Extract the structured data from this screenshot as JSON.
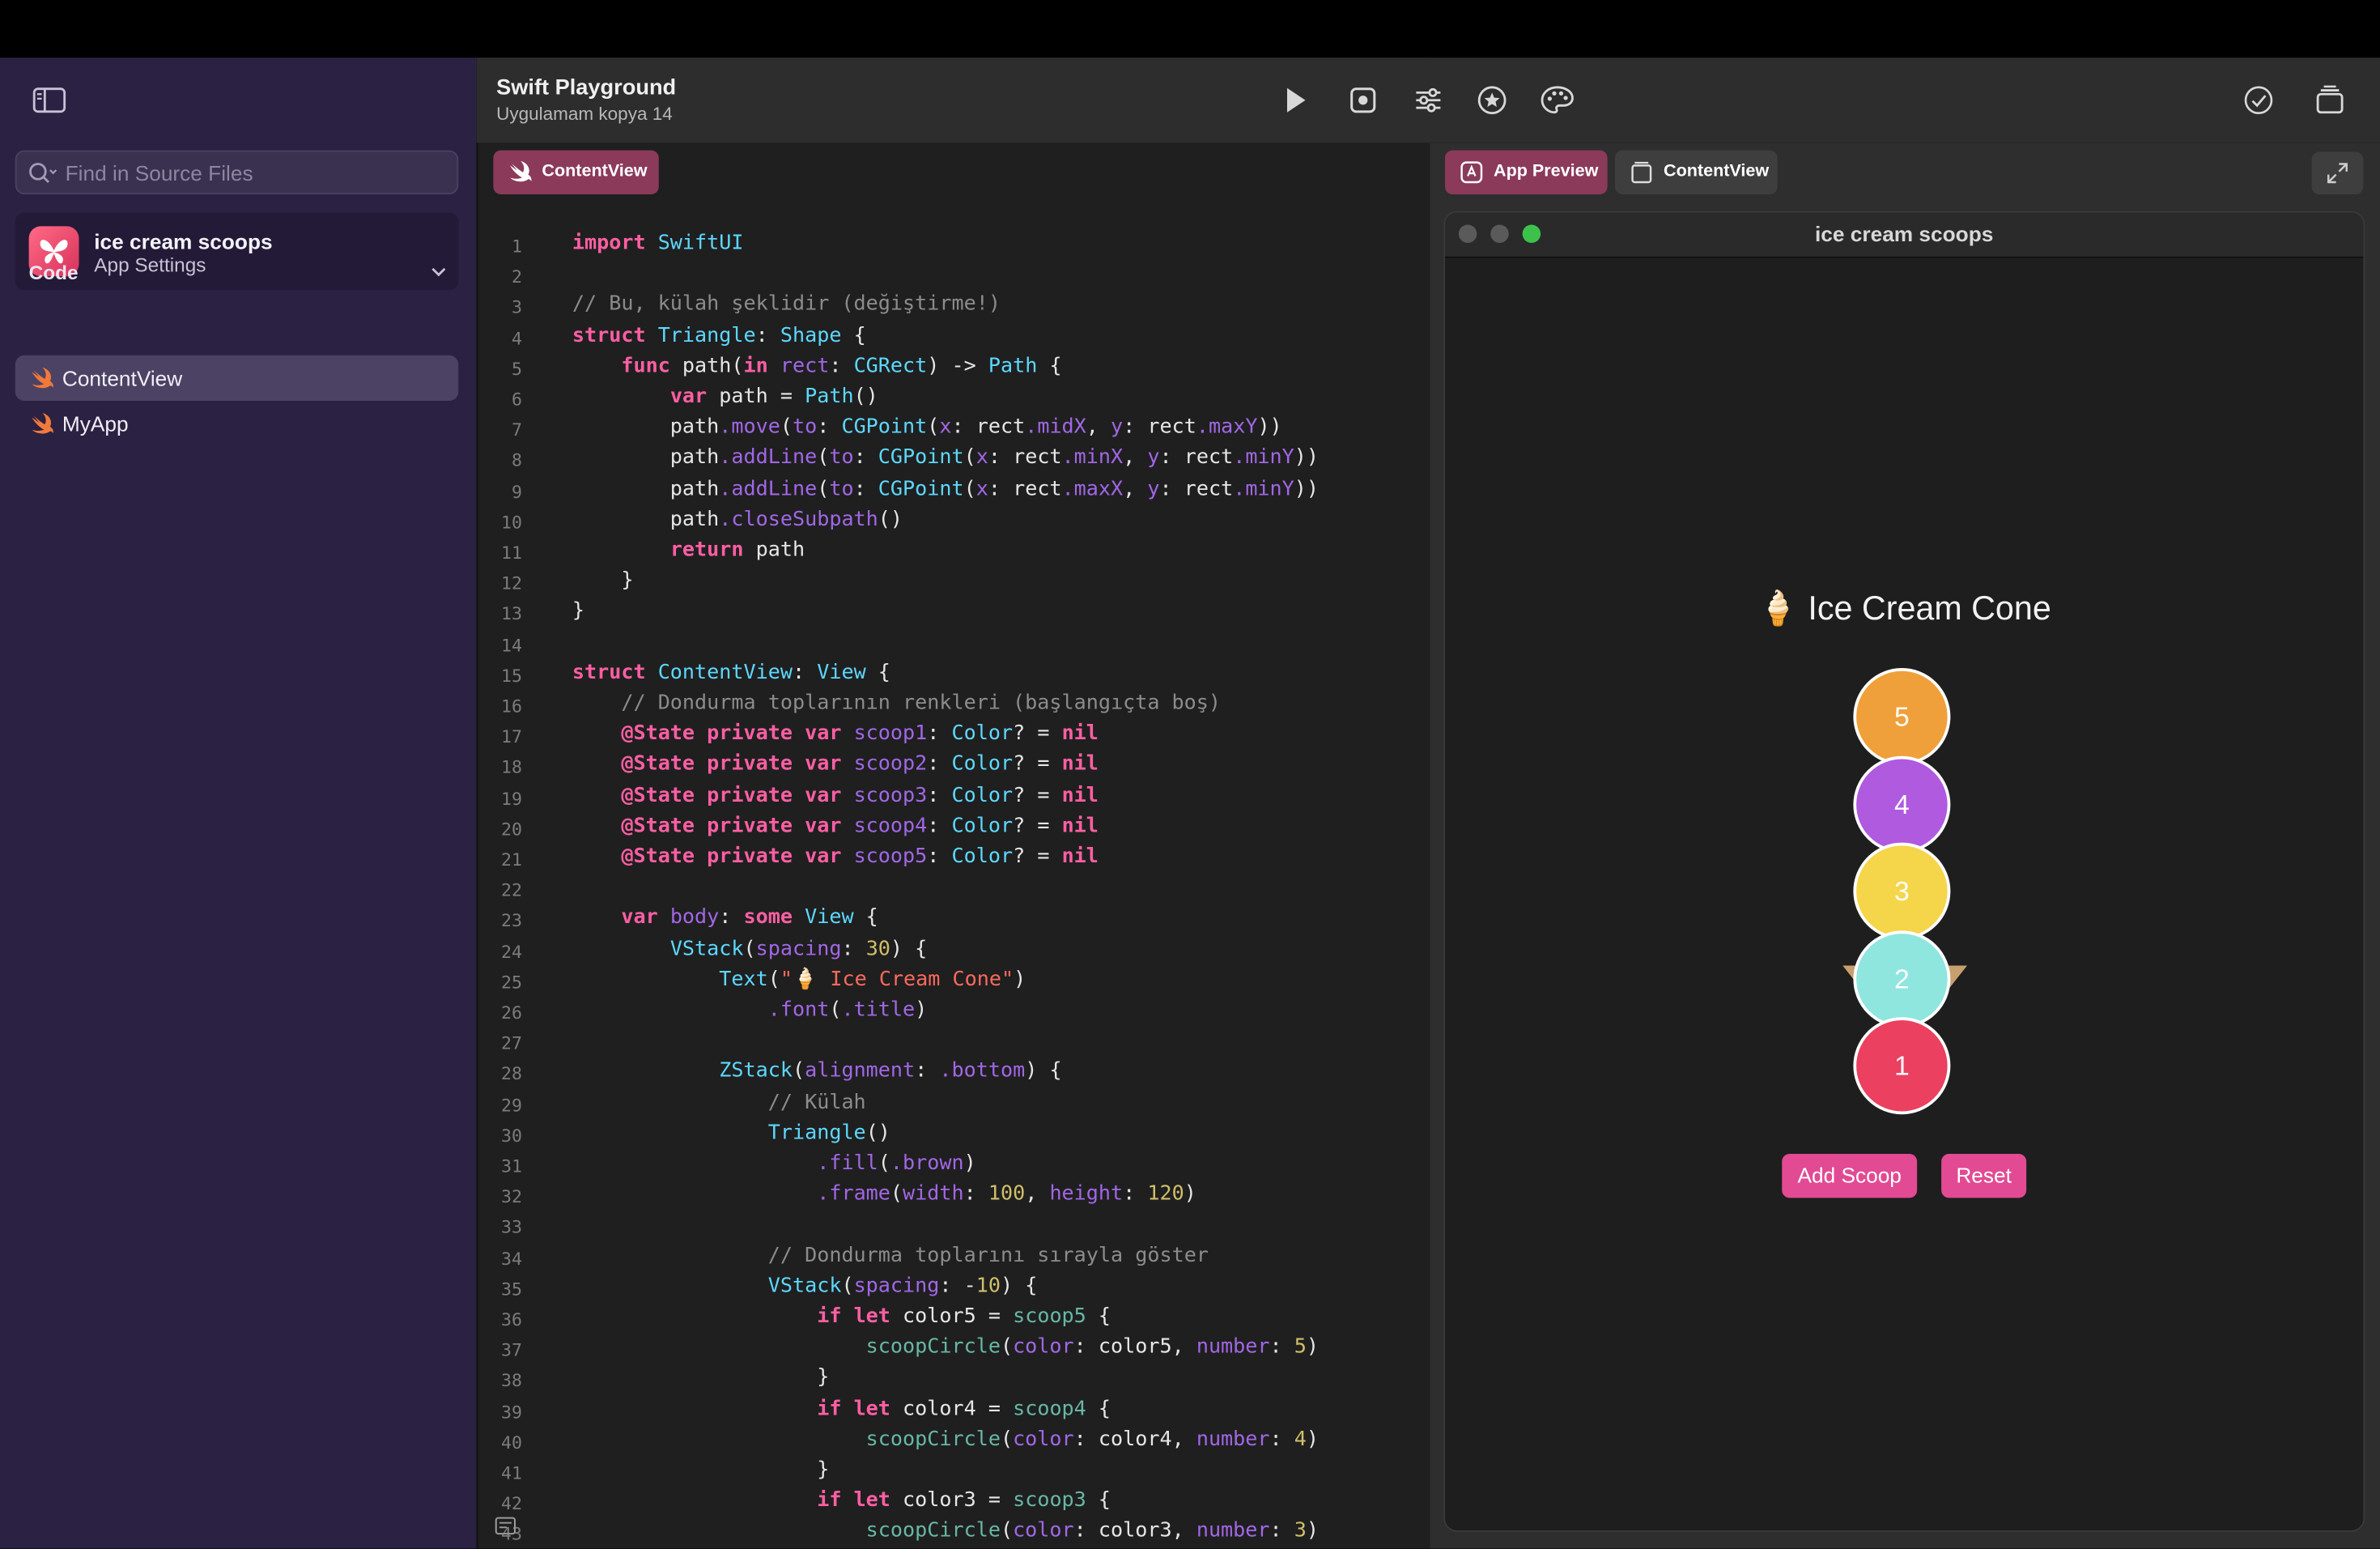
{
  "window": {
    "title": "Swift Playground",
    "subtitle": "Uygulamam kopya 14"
  },
  "sidebar": {
    "search_placeholder": "Find in Source Files",
    "app": {
      "name": "ice cream scoops",
      "subtitle": "App Settings"
    },
    "section_title": "Code",
    "files": [
      {
        "label": "ContentView",
        "active": true
      },
      {
        "label": "MyApp",
        "active": false
      }
    ]
  },
  "toolbar": {
    "icons": [
      "run-icon",
      "record-icon",
      "settings-sliders-icon",
      "favorites-icon",
      "palette-icon",
      "checkmark-icon",
      "library-icon"
    ]
  },
  "editor": {
    "tab_label": "ContentView",
    "lines": [
      {
        "n": "1",
        "text": "import SwiftUI"
      },
      {
        "n": "2",
        "text": ""
      },
      {
        "n": "3",
        "text": "// Bu, külah şeklidir (değiştirme!)"
      },
      {
        "n": "4",
        "text": "struct Triangle: Shape {"
      },
      {
        "n": "5",
        "text": "    func path(in rect: CGRect) -> Path {"
      },
      {
        "n": "6",
        "text": "        var path = Path()"
      },
      {
        "n": "7",
        "text": "        path.move(to: CGPoint(x: rect.midX, y: rect.maxY))"
      },
      {
        "n": "8",
        "text": "        path.addLine(to: CGPoint(x: rect.minX, y: rect.minY))"
      },
      {
        "n": "9",
        "text": "        path.addLine(to: CGPoint(x: rect.maxX, y: rect.minY))"
      },
      {
        "n": "10",
        "text": "        path.closeSubpath()"
      },
      {
        "n": "11",
        "text": "        return path"
      },
      {
        "n": "12",
        "text": "    }"
      },
      {
        "n": "13",
        "text": "}"
      },
      {
        "n": "14",
        "text": ""
      },
      {
        "n": "15",
        "text": "struct ContentView: View {"
      },
      {
        "n": "16",
        "text": "    // Dondurma toplarının renkleri (başlangıçta boş)"
      },
      {
        "n": "17",
        "text": "    @State private var scoop1: Color? = nil"
      },
      {
        "n": "18",
        "text": "    @State private var scoop2: Color? = nil"
      },
      {
        "n": "19",
        "text": "    @State private var scoop3: Color? = nil"
      },
      {
        "n": "20",
        "text": "    @State private var scoop4: Color? = nil"
      },
      {
        "n": "21",
        "text": "    @State private var scoop5: Color? = nil"
      },
      {
        "n": "22",
        "text": ""
      },
      {
        "n": "23",
        "text": "    var body: some View {"
      },
      {
        "n": "24",
        "text": "        VStack(spacing: 30) {"
      },
      {
        "n": "25",
        "text": "            Text(\"🍦 Ice Cream Cone\")"
      },
      {
        "n": "26",
        "text": "                .font(.title)"
      },
      {
        "n": "27",
        "text": ""
      },
      {
        "n": "28",
        "text": "            ZStack(alignment: .bottom) {"
      },
      {
        "n": "29",
        "text": "                // Külah"
      },
      {
        "n": "30",
        "text": "                Triangle()"
      },
      {
        "n": "31",
        "text": "                    .fill(.brown)"
      },
      {
        "n": "32",
        "text": "                    .frame(width: 100, height: 120)"
      },
      {
        "n": "33",
        "text": ""
      },
      {
        "n": "34",
        "text": "                // Dondurma toplarını sırayla göster"
      },
      {
        "n": "35",
        "text": "                VStack(spacing: -10) {"
      },
      {
        "n": "36",
        "text": "                    if let color5 = scoop5 {"
      },
      {
        "n": "37",
        "text": "                        scoopCircle(color: color5, number: 5)"
      },
      {
        "n": "38",
        "text": "                    }"
      },
      {
        "n": "39",
        "text": "                    if let color4 = scoop4 {"
      },
      {
        "n": "40",
        "text": "                        scoopCircle(color: color4, number: 4)"
      },
      {
        "n": "41",
        "text": "                    }"
      },
      {
        "n": "42",
        "text": "                    if let color3 = scoop3 {"
      },
      {
        "n": "43",
        "text": "                        scoopCircle(color: color3, number: 3)"
      }
    ]
  },
  "preview": {
    "tabs": [
      {
        "label": "App Preview",
        "active": true
      },
      {
        "label": "ContentView",
        "active": false
      }
    ],
    "window_title": "ice cream scoops",
    "heading": "🍦 Ice Cream Cone",
    "scoops": [
      {
        "label": "5",
        "color": "#f0a03a"
      },
      {
        "label": "4",
        "color": "#b05ae0"
      },
      {
        "label": "3",
        "color": "#f5d54a"
      },
      {
        "label": "2",
        "color": "#8ee6df"
      },
      {
        "label": "1",
        "color": "#eb4060"
      }
    ],
    "cone_color": "#c8a06e",
    "buttons": {
      "add": "Add Scoop",
      "reset": "Reset"
    }
  },
  "colors": {
    "sidebar_bg": "#2b2142",
    "accent": "#8b3a5a",
    "button": "#e24a94"
  }
}
